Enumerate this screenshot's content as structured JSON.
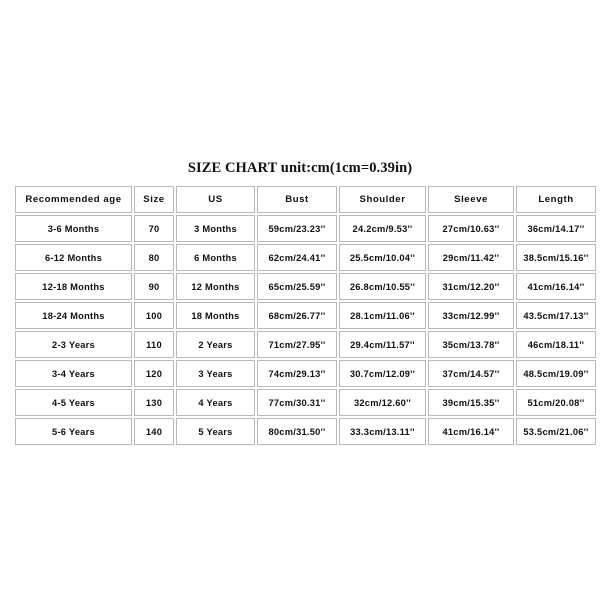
{
  "title": "SIZE CHART unit:cm(1cm=0.39in)",
  "chart_data": {
    "type": "table",
    "title": "SIZE CHART unit:cm(1cm=0.39in)",
    "columns": [
      "Recommended age",
      "Size",
      "US",
      "Bust",
      "Shoulder",
      "Sleeve",
      "Length"
    ],
    "rows": [
      {
        "age": "3-6 Months",
        "size": "70",
        "us": "3 Months",
        "bust": "59cm/23.23''",
        "shoulder": "24.2cm/9.53''",
        "sleeve": "27cm/10.63''",
        "length": "36cm/14.17''"
      },
      {
        "age": "6-12 Months",
        "size": "80",
        "us": "6 Months",
        "bust": "62cm/24.41''",
        "shoulder": "25.5cm/10.04''",
        "sleeve": "29cm/11.42''",
        "length": "38.5cm/15.16''"
      },
      {
        "age": "12-18 Months",
        "size": "90",
        "us": "12 Months",
        "bust": "65cm/25.59''",
        "shoulder": "26.8cm/10.55''",
        "sleeve": "31cm/12.20''",
        "length": "41cm/16.14''"
      },
      {
        "age": "18-24 Months",
        "size": "100",
        "us": "18 Months",
        "bust": "68cm/26.77''",
        "shoulder": "28.1cm/11.06''",
        "sleeve": "33cm/12.99''",
        "length": "43.5cm/17.13''"
      },
      {
        "age": "2-3 Years",
        "size": "110",
        "us": "2 Years",
        "bust": "71cm/27.95''",
        "shoulder": "29.4cm/11.57''",
        "sleeve": "35cm/13.78''",
        "length": "46cm/18.11''"
      },
      {
        "age": "3-4 Years",
        "size": "120",
        "us": "3 Years",
        "bust": "74cm/29.13''",
        "shoulder": "30.7cm/12.09''",
        "sleeve": "37cm/14.57''",
        "length": "48.5cm/19.09''"
      },
      {
        "age": "4-5 Years",
        "size": "130",
        "us": "4 Years",
        "bust": "77cm/30.31''",
        "shoulder": "32cm/12.60''",
        "sleeve": "39cm/15.35''",
        "length": "51cm/20.08''"
      },
      {
        "age": "5-6 Years",
        "size": "140",
        "us": "5 Years",
        "bust": "80cm/31.50''",
        "shoulder": "33.3cm/13.11''",
        "sleeve": "41cm/16.14''",
        "length": "53.5cm/21.06''"
      }
    ],
    "colors": {
      "background": "#ffffff",
      "text": "#101010",
      "border": "#b9b9b9"
    }
  }
}
